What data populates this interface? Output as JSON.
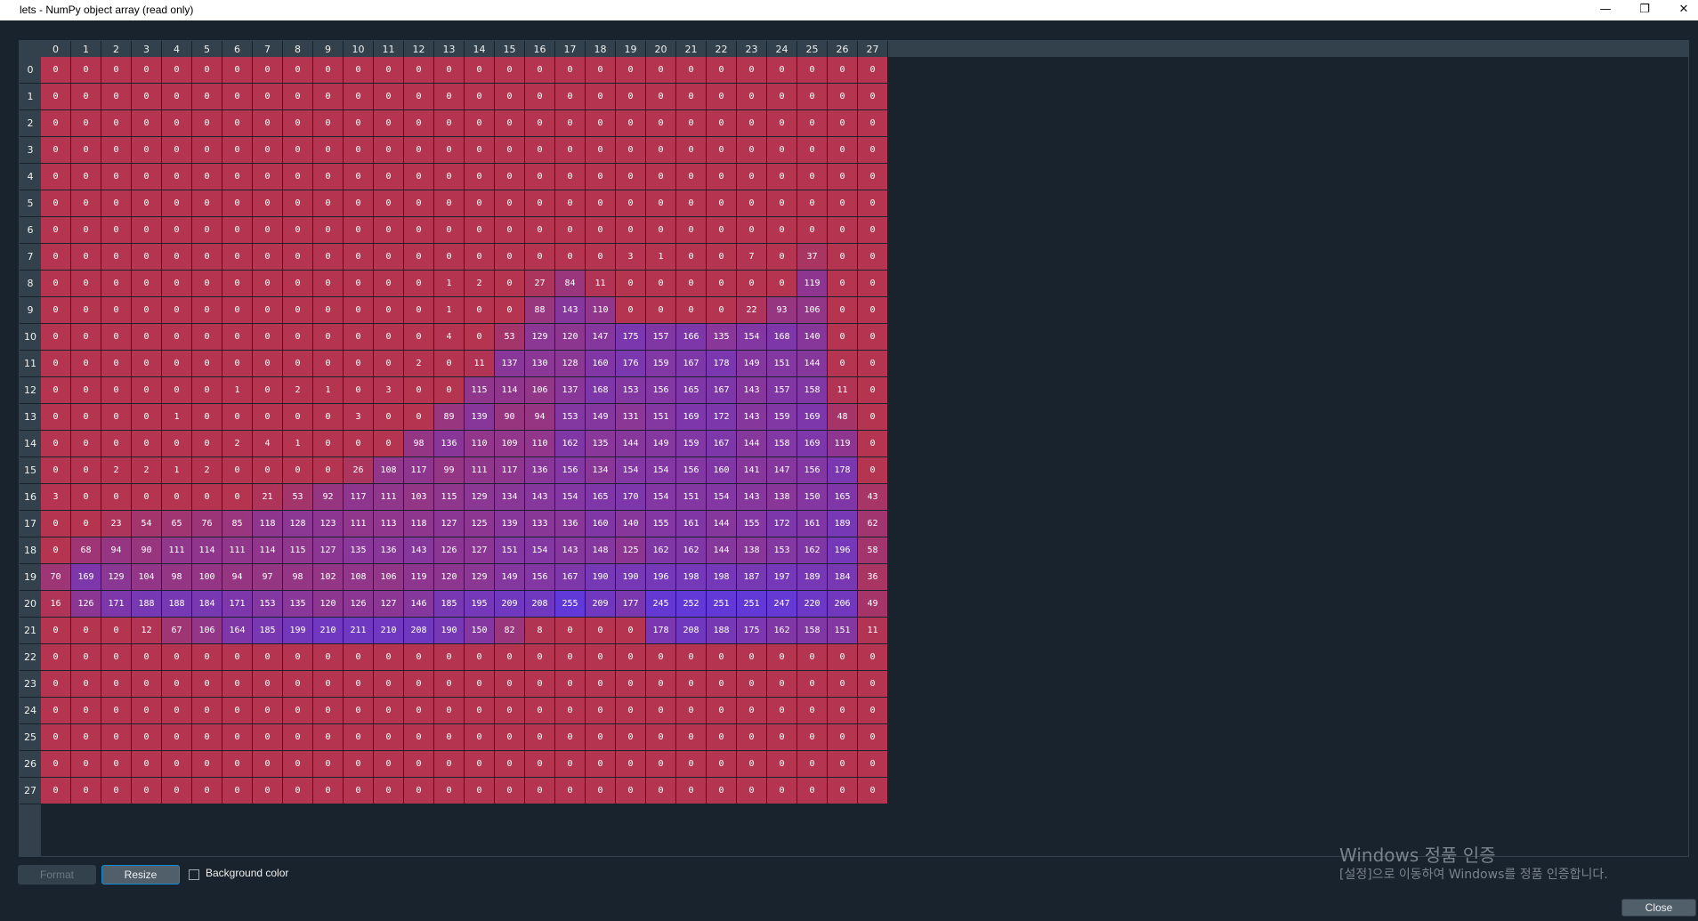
{
  "window": {
    "title": "lets - NumPy object array (read only)",
    "minimize_glyph": "—",
    "restore_glyph": "❐",
    "close_glyph": "✕"
  },
  "array": {
    "dtype": "object",
    "shape": [
      28,
      28
    ],
    "column_headers": [
      "0",
      "1",
      "2",
      "3",
      "4",
      "5",
      "6",
      "7",
      "8",
      "9",
      "10",
      "11",
      "12",
      "13",
      "14",
      "15",
      "16",
      "17",
      "18",
      "19",
      "20",
      "21",
      "22",
      "23",
      "24",
      "25",
      "26",
      "27"
    ],
    "row_headers": [
      "0",
      "1",
      "2",
      "3",
      "4",
      "5",
      "6",
      "7",
      "8",
      "9",
      "10",
      "11",
      "12",
      "13",
      "14",
      "15",
      "16",
      "17",
      "18",
      "19",
      "20",
      "21",
      "22",
      "23",
      "24",
      "25",
      "26",
      "27"
    ],
    "background_color_min": "#b5344f",
    "background_color_max": "#6139d8",
    "values": [
      [
        0,
        0,
        0,
        0,
        0,
        0,
        0,
        0,
        0,
        0,
        0,
        0,
        0,
        0,
        0,
        0,
        0,
        0,
        0,
        0,
        0,
        0,
        0,
        0,
        0,
        0,
        0,
        0
      ],
      [
        0,
        0,
        0,
        0,
        0,
        0,
        0,
        0,
        0,
        0,
        0,
        0,
        0,
        0,
        0,
        0,
        0,
        0,
        0,
        0,
        0,
        0,
        0,
        0,
        0,
        0,
        0,
        0
      ],
      [
        0,
        0,
        0,
        0,
        0,
        0,
        0,
        0,
        0,
        0,
        0,
        0,
        0,
        0,
        0,
        0,
        0,
        0,
        0,
        0,
        0,
        0,
        0,
        0,
        0,
        0,
        0,
        0
      ],
      [
        0,
        0,
        0,
        0,
        0,
        0,
        0,
        0,
        0,
        0,
        0,
        0,
        0,
        0,
        0,
        0,
        0,
        0,
        0,
        0,
        0,
        0,
        0,
        0,
        0,
        0,
        0,
        0
      ],
      [
        0,
        0,
        0,
        0,
        0,
        0,
        0,
        0,
        0,
        0,
        0,
        0,
        0,
        0,
        0,
        0,
        0,
        0,
        0,
        0,
        0,
        0,
        0,
        0,
        0,
        0,
        0,
        0
      ],
      [
        0,
        0,
        0,
        0,
        0,
        0,
        0,
        0,
        0,
        0,
        0,
        0,
        0,
        0,
        0,
        0,
        0,
        0,
        0,
        0,
        0,
        0,
        0,
        0,
        0,
        0,
        0,
        0
      ],
      [
        0,
        0,
        0,
        0,
        0,
        0,
        0,
        0,
        0,
        0,
        0,
        0,
        0,
        0,
        0,
        0,
        0,
        0,
        0,
        0,
        0,
        0,
        0,
        0,
        0,
        0,
        0,
        0
      ],
      [
        0,
        0,
        0,
        0,
        0,
        0,
        0,
        0,
        0,
        0,
        0,
        0,
        0,
        0,
        0,
        0,
        0,
        0,
        0,
        3,
        1,
        0,
        0,
        7,
        0,
        37,
        0,
        0
      ],
      [
        0,
        0,
        0,
        0,
        0,
        0,
        0,
        0,
        0,
        0,
        0,
        0,
        0,
        1,
        2,
        0,
        27,
        84,
        11,
        0,
        0,
        0,
        0,
        0,
        0,
        119,
        0,
        0
      ],
      [
        0,
        0,
        0,
        0,
        0,
        0,
        0,
        0,
        0,
        0,
        0,
        0,
        0,
        1,
        0,
        0,
        88,
        143,
        110,
        0,
        0,
        0,
        0,
        22,
        93,
        106,
        0,
        0
      ],
      [
        0,
        0,
        0,
        0,
        0,
        0,
        0,
        0,
        0,
        0,
        0,
        0,
        0,
        4,
        0,
        53,
        129,
        120,
        147,
        175,
        157,
        166,
        135,
        154,
        168,
        140,
        0,
        0
      ],
      [
        0,
        0,
        0,
        0,
        0,
        0,
        0,
        0,
        0,
        0,
        0,
        0,
        2,
        0,
        11,
        137,
        130,
        128,
        160,
        176,
        159,
        167,
        178,
        149,
        151,
        144,
        0,
        0
      ],
      [
        0,
        0,
        0,
        0,
        0,
        0,
        1,
        0,
        2,
        1,
        0,
        3,
        0,
        0,
        115,
        114,
        106,
        137,
        168,
        153,
        156,
        165,
        167,
        143,
        157,
        158,
        11,
        0
      ],
      [
        0,
        0,
        0,
        0,
        1,
        0,
        0,
        0,
        0,
        0,
        3,
        0,
        0,
        89,
        139,
        90,
        94,
        153,
        149,
        131,
        151,
        169,
        172,
        143,
        159,
        169,
        48,
        0
      ],
      [
        0,
        0,
        0,
        0,
        0,
        0,
        2,
        4,
        1,
        0,
        0,
        0,
        98,
        136,
        110,
        109,
        110,
        162,
        135,
        144,
        149,
        159,
        167,
        144,
        158,
        169,
        119,
        0
      ],
      [
        0,
        0,
        2,
        2,
        1,
        2,
        0,
        0,
        0,
        0,
        26,
        108,
        117,
        99,
        111,
        117,
        136,
        156,
        134,
        154,
        154,
        156,
        160,
        141,
        147,
        156,
        178,
        0
      ],
      [
        3,
        0,
        0,
        0,
        0,
        0,
        0,
        21,
        53,
        92,
        117,
        111,
        103,
        115,
        129,
        134,
        143,
        154,
        165,
        170,
        154,
        151,
        154,
        143,
        138,
        150,
        165,
        43
      ],
      [
        0,
        0,
        23,
        54,
        65,
        76,
        85,
        118,
        128,
        123,
        111,
        113,
        118,
        127,
        125,
        139,
        133,
        136,
        160,
        140,
        155,
        161,
        144,
        155,
        172,
        161,
        189,
        62
      ],
      [
        0,
        68,
        94,
        90,
        111,
        114,
        111,
        114,
        115,
        127,
        135,
        136,
        143,
        126,
        127,
        151,
        154,
        143,
        148,
        125,
        162,
        162,
        144,
        138,
        153,
        162,
        196,
        58
      ],
      [
        70,
        169,
        129,
        104,
        98,
        100,
        94,
        97,
        98,
        102,
        108,
        106,
        119,
        120,
        129,
        149,
        156,
        167,
        190,
        190,
        196,
        198,
        198,
        187,
        197,
        189,
        184,
        36
      ],
      [
        16,
        126,
        171,
        188,
        188,
        184,
        171,
        153,
        135,
        120,
        126,
        127,
        146,
        185,
        195,
        209,
        208,
        255,
        209,
        177,
        245,
        252,
        251,
        251,
        247,
        220,
        206,
        49
      ],
      [
        0,
        0,
        0,
        12,
        67,
        106,
        164,
        185,
        199,
        210,
        211,
        210,
        208,
        190,
        150,
        82,
        8,
        0,
        0,
        0,
        178,
        208,
        188,
        175,
        162,
        158,
        151,
        11
      ],
      [
        0,
        0,
        0,
        0,
        0,
        0,
        0,
        0,
        0,
        0,
        0,
        0,
        0,
        0,
        0,
        0,
        0,
        0,
        0,
        0,
        0,
        0,
        0,
        0,
        0,
        0,
        0,
        0
      ],
      [
        0,
        0,
        0,
        0,
        0,
        0,
        0,
        0,
        0,
        0,
        0,
        0,
        0,
        0,
        0,
        0,
        0,
        0,
        0,
        0,
        0,
        0,
        0,
        0,
        0,
        0,
        0,
        0
      ],
      [
        0,
        0,
        0,
        0,
        0,
        0,
        0,
        0,
        0,
        0,
        0,
        0,
        0,
        0,
        0,
        0,
        0,
        0,
        0,
        0,
        0,
        0,
        0,
        0,
        0,
        0,
        0,
        0
      ],
      [
        0,
        0,
        0,
        0,
        0,
        0,
        0,
        0,
        0,
        0,
        0,
        0,
        0,
        0,
        0,
        0,
        0,
        0,
        0,
        0,
        0,
        0,
        0,
        0,
        0,
        0,
        0,
        0
      ],
      [
        0,
        0,
        0,
        0,
        0,
        0,
        0,
        0,
        0,
        0,
        0,
        0,
        0,
        0,
        0,
        0,
        0,
        0,
        0,
        0,
        0,
        0,
        0,
        0,
        0,
        0,
        0,
        0
      ],
      [
        0,
        0,
        0,
        0,
        0,
        0,
        0,
        0,
        0,
        0,
        0,
        0,
        0,
        0,
        0,
        0,
        0,
        0,
        0,
        0,
        0,
        0,
        0,
        0,
        0,
        0,
        0,
        0
      ]
    ]
  },
  "controls": {
    "format_label": "Format",
    "format_enabled": false,
    "resize_label": "Resize",
    "background_color_label": "Background color",
    "background_color_checked": false,
    "close_label": "Close"
  },
  "watermark": {
    "line1": "Windows 정품 인증",
    "line2": "[설정]으로 이동하여 Windows를 정품 인증합니다."
  }
}
